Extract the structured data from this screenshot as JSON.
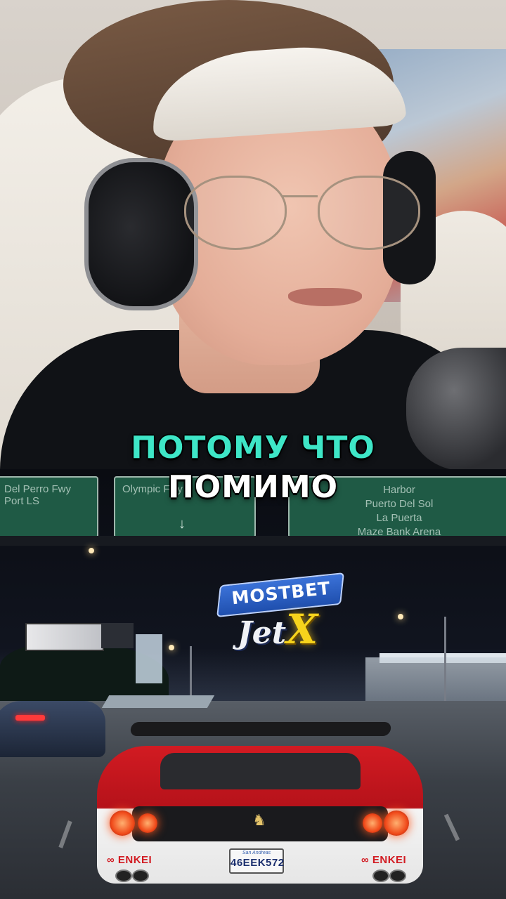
{
  "captions": {
    "line1": "ПОТОМУ ЧТО",
    "line2": "ПОМИМО",
    "line1_color": "#3ee6c7",
    "line2_color": "#ffffff"
  },
  "signs": [
    {
      "lines": [
        "Del Perro Fwy",
        "Port LS"
      ]
    },
    {
      "lines": [
        "Olympic Fwy"
      ]
    },
    {
      "lines": [
        "Harbor",
        "Puerto Del Sol",
        "La Puerta",
        "Maze Bank Arena"
      ]
    }
  ],
  "logo": {
    "top": "MOSTBET",
    "bottom": "Jet",
    "x": "X"
  },
  "car": {
    "plate_state": "San Andreas",
    "plate_number": "46EEK572",
    "decal_left": "∞ ENKEI",
    "decal_right": "∞ ENKEI"
  }
}
